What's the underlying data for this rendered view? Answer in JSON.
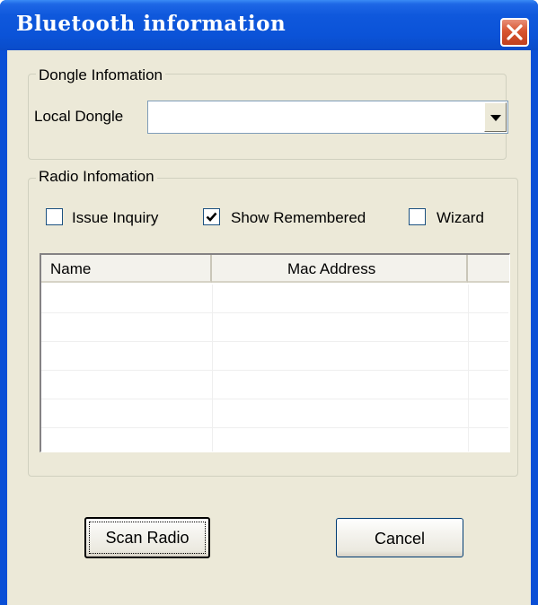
{
  "window": {
    "title": "Bluetooth information",
    "close_icon": "close-icon",
    "titlebar_color": "#0a4fd6",
    "close_color": "#d8542f",
    "face_color": "#ece9d8"
  },
  "dongle_group": {
    "legend": "Dongle Infomation",
    "local_dongle_label": "Local Dongle",
    "local_dongle_value": "",
    "dropdown_icon": "chevron-down-icon"
  },
  "radio_group": {
    "legend": "Radio Infomation",
    "checkboxes": [
      {
        "label": "Issue Inquiry",
        "checked": false
      },
      {
        "label": "Show Remembered",
        "checked": true
      },
      {
        "label": "Wizard",
        "checked": false
      }
    ],
    "list": {
      "columns": [
        "Name",
        "Mac Address",
        ""
      ],
      "rows": []
    }
  },
  "buttons": {
    "scan": "Scan Radio",
    "cancel": "Cancel"
  }
}
